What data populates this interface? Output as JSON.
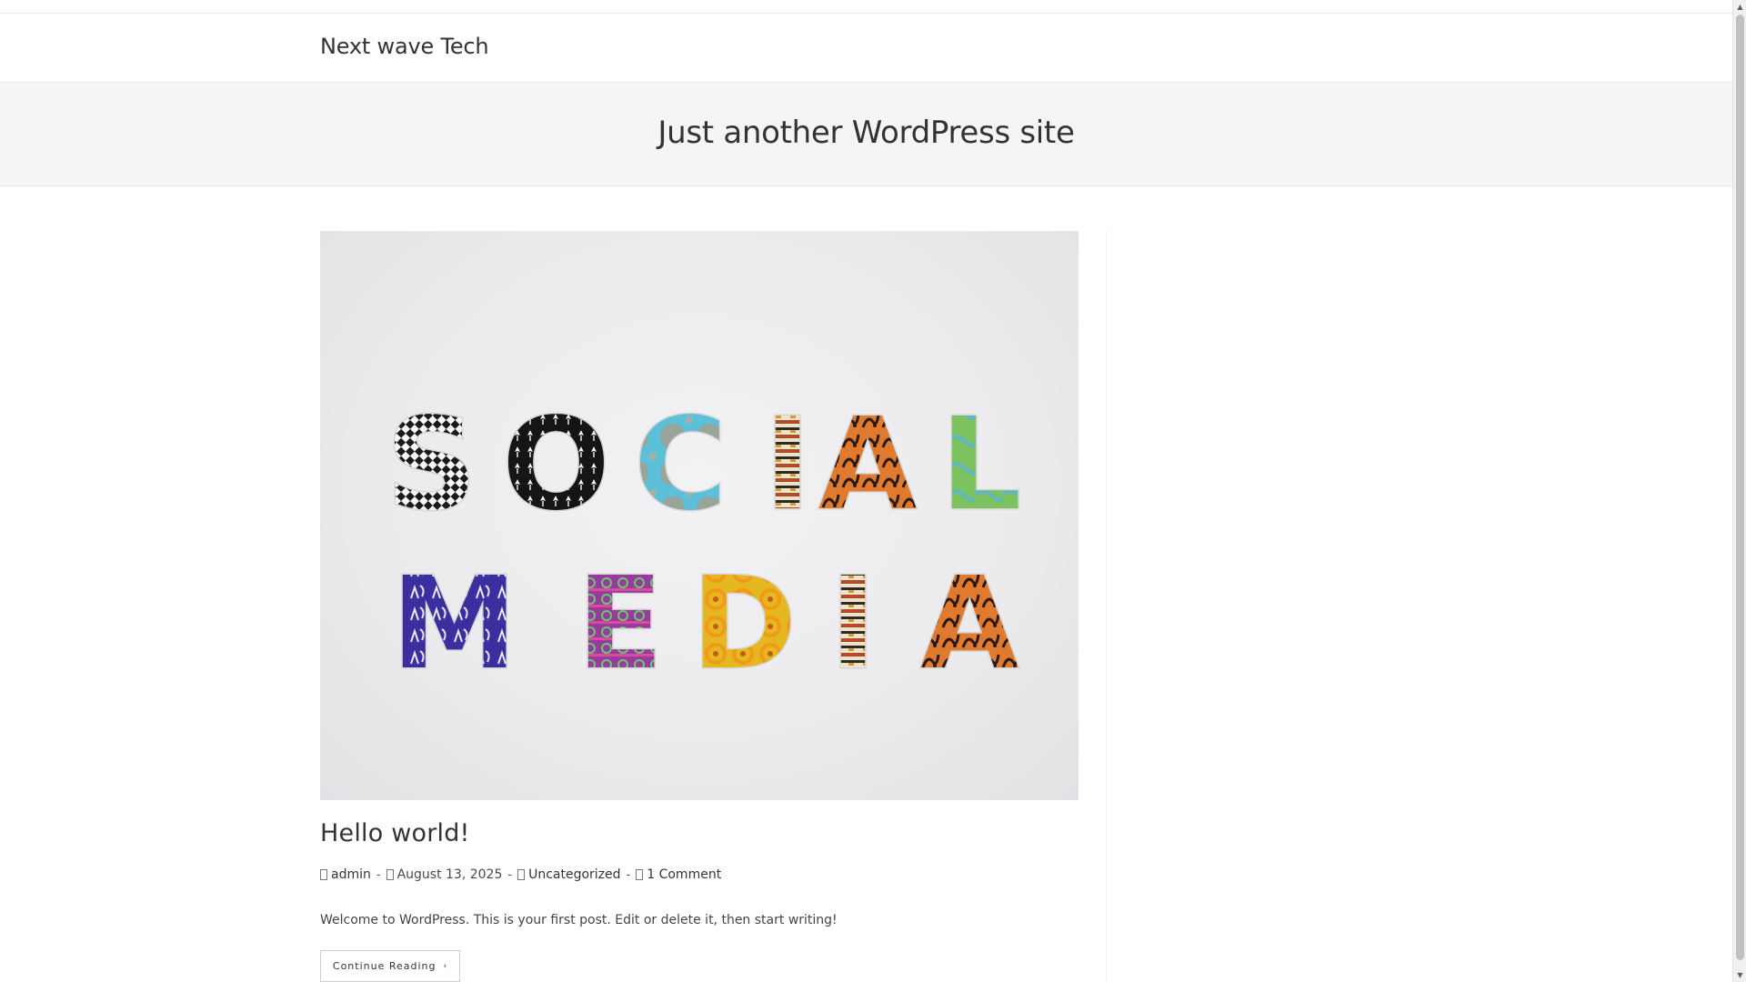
{
  "site": {
    "title": "Next wave Tech",
    "tagline": "Just another WordPress site"
  },
  "post": {
    "title": "Hello world!",
    "image_text": [
      "SOCIAL",
      "MEDIA"
    ],
    "meta": {
      "author": "admin",
      "date": "August 13, 2025",
      "category": "Uncategorized",
      "comments": "1 Comment"
    },
    "excerpt": "Welcome to WordPress. This is your first post. Edit or delete it, then start writing!",
    "read_more": "Continue Reading",
    "read_more_icon": "chevron-right-icon"
  },
  "scrollbar": {
    "up_icon": "▲",
    "down_icon": "▼"
  },
  "colors": {
    "text": "#333333",
    "header_band": "#f5f5f5",
    "border": "#eaeaea"
  }
}
